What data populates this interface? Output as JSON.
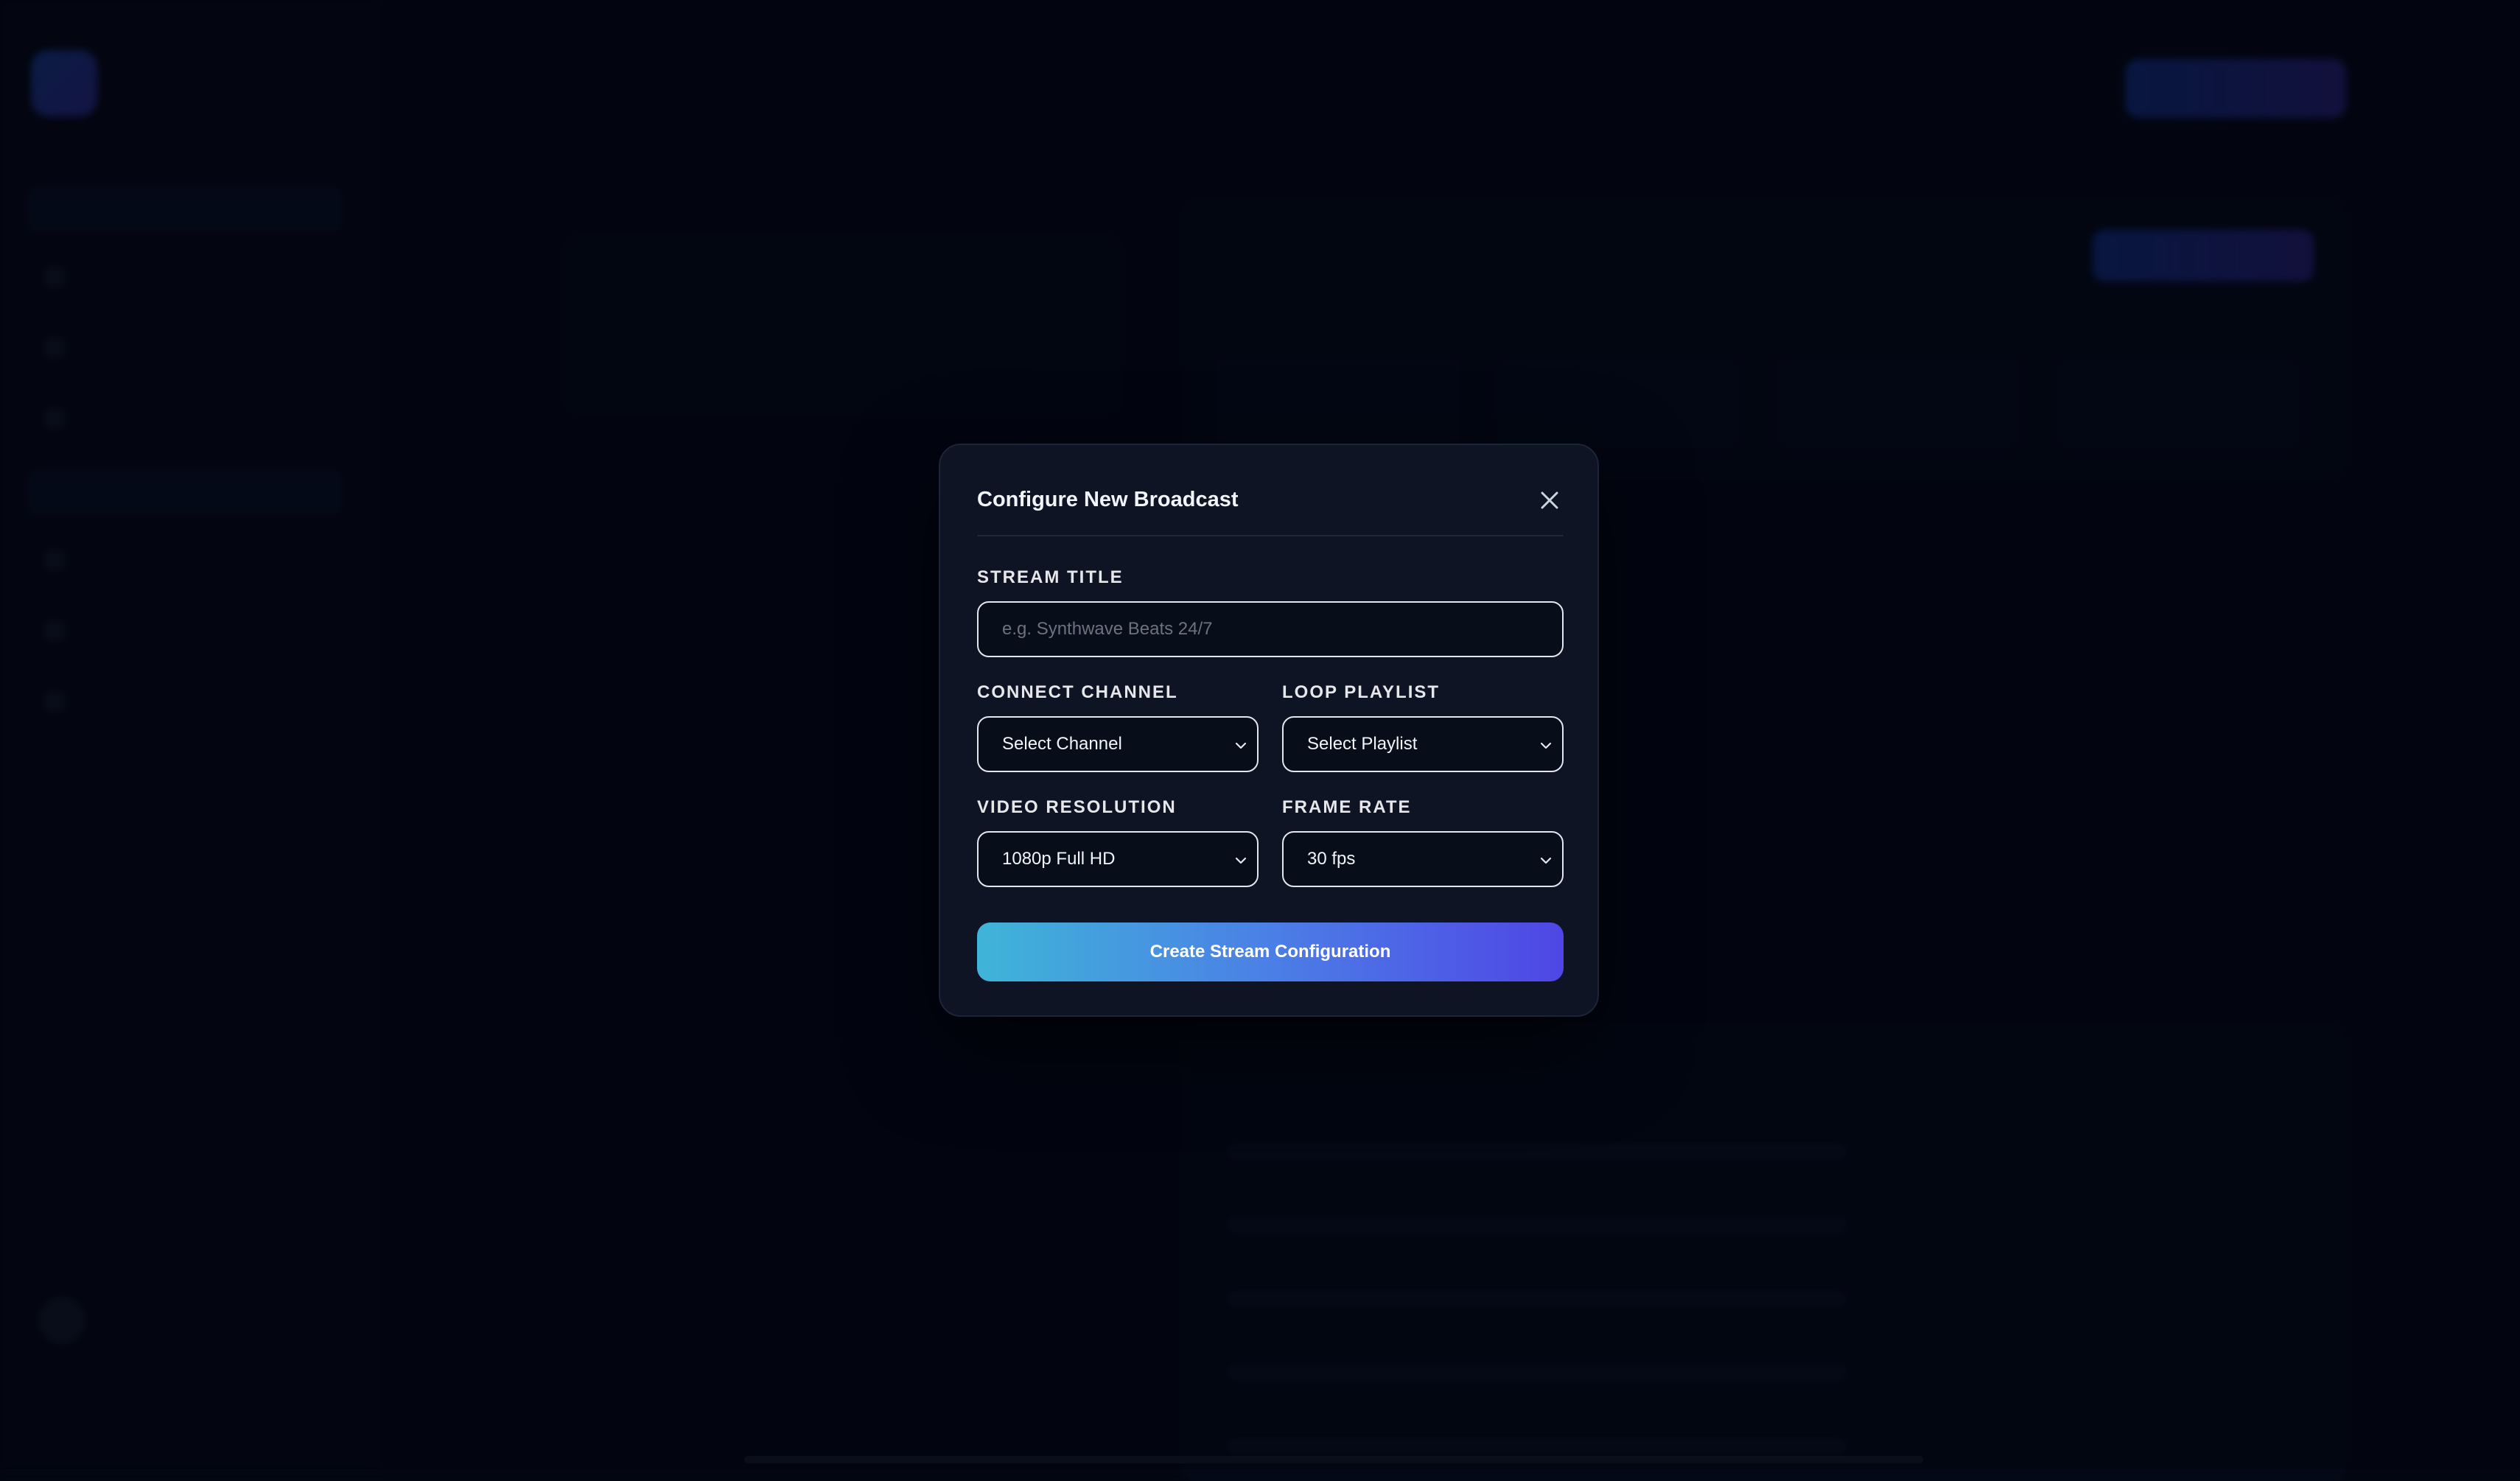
{
  "modal": {
    "title": "Configure New Broadcast",
    "stream_title": {
      "label": "STREAM TITLE",
      "placeholder": "e.g. Synthwave Beats 24/7",
      "value": ""
    },
    "connect_channel": {
      "label": "CONNECT CHANNEL",
      "selected": "Select Channel"
    },
    "loop_playlist": {
      "label": "LOOP PLAYLIST",
      "selected": "Select Playlist"
    },
    "video_resolution": {
      "label": "VIDEO RESOLUTION",
      "selected": "1080p Full HD"
    },
    "frame_rate": {
      "label": "FRAME RATE",
      "selected": "30 fps"
    },
    "submit_label": "Create Stream Configuration"
  },
  "colors": {
    "button_gradient_start": "#3fb5d8",
    "button_gradient_end": "#4f46e5",
    "modal_background": "#0e1424",
    "page_background": "#030712"
  },
  "icons": {
    "close": "close-icon",
    "dropdown": "chevron-down-icon"
  }
}
